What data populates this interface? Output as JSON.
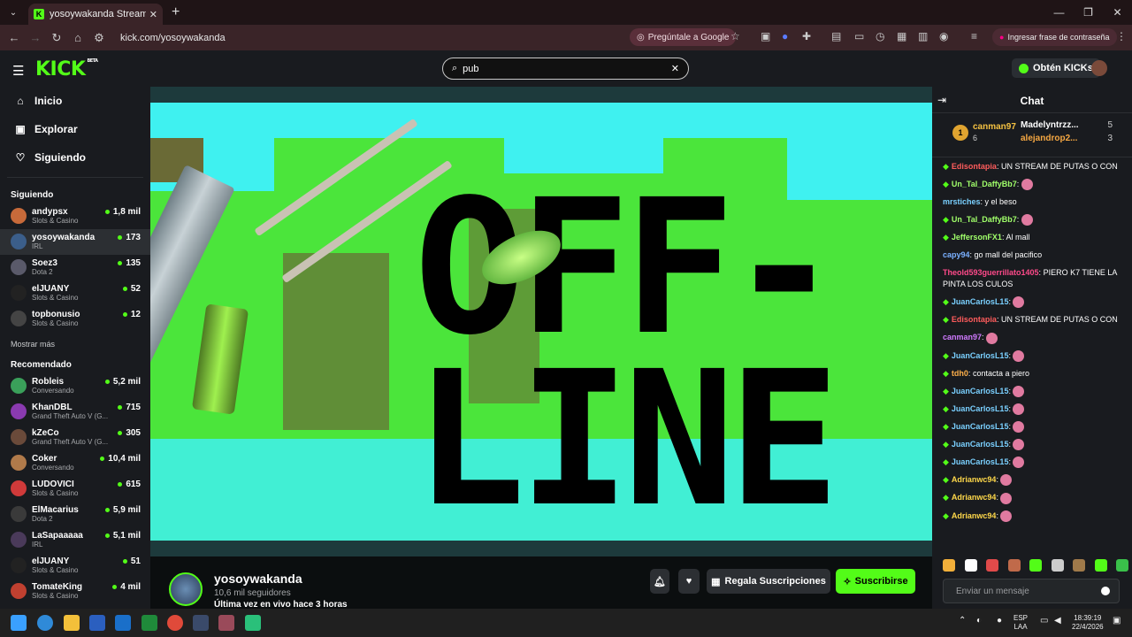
{
  "browser": {
    "tab_title": "yosoywakanda Stream - Watch",
    "url": "kick.com/yosoywakanda",
    "google_pill": "Pregúntale a Google",
    "password_pill": "Ingresar frase de contraseña"
  },
  "header": {
    "logo": "KICK",
    "logo_badge": "BETA",
    "search_value": "pub",
    "kicks_label": "Obtén KICKs"
  },
  "sidebar": {
    "nav": [
      {
        "label": "Inicio",
        "icon": "home-icon"
      },
      {
        "label": "Explorar",
        "icon": "compass-icon"
      },
      {
        "label": "Siguiendo",
        "icon": "heart-icon"
      }
    ],
    "following_title": "Siguiendo",
    "following": [
      {
        "name": "andypsx",
        "category": "Slots & Casino",
        "viewers": "1,8 mil",
        "color": "#c76a3a"
      },
      {
        "name": "yosoywakanda",
        "category": "IRL",
        "viewers": "173",
        "color": "#3b5e8a"
      },
      {
        "name": "Soez3",
        "category": "Dota 2",
        "viewers": "135",
        "color": "#5a5a6a"
      },
      {
        "name": "elJUANY",
        "category": "Slots & Casino",
        "viewers": "52",
        "color": "#222"
      },
      {
        "name": "topbonusio",
        "category": "Slots & Casino",
        "viewers": "12",
        "color": "#444"
      }
    ],
    "show_more": "Mostrar más",
    "recommended_title": "Recomendado",
    "recommended": [
      {
        "name": "Robleis",
        "category": "Conversando",
        "viewers": "5,2 mil",
        "color": "#3aa05a"
      },
      {
        "name": "KhanDBL",
        "category": "Grand Theft Auto V (G...",
        "viewers": "715",
        "color": "#8a3ab0"
      },
      {
        "name": "kZeCo",
        "category": "Grand Theft Auto V (G...",
        "viewers": "305",
        "color": "#6a4a3a"
      },
      {
        "name": "Coker",
        "category": "Conversando",
        "viewers": "10,4 mil",
        "color": "#b07a4a"
      },
      {
        "name": "LUDOVICI",
        "category": "Slots & Casino",
        "viewers": "615",
        "color": "#d03a3a"
      },
      {
        "name": "ElMacarius",
        "category": "Dota 2",
        "viewers": "5,9 mil",
        "color": "#3a3a3a"
      },
      {
        "name": "LaSapaaaaa",
        "category": "IRL",
        "viewers": "5,1 mil",
        "color": "#4a3a5a"
      },
      {
        "name": "elJUANY",
        "category": "Slots & Casino",
        "viewers": "51",
        "color": "#222"
      },
      {
        "name": "TomateKing",
        "category": "Slots & Casino",
        "viewers": "4 mil",
        "color": "#c04030"
      }
    ]
  },
  "player": {
    "offline_line1": "OFF-",
    "offline_line2": "LINE"
  },
  "channel": {
    "name": "yosoywakanda",
    "followers": "10,6 mil seguidores",
    "last_live": "Última vez en vivo hace 3 horas",
    "gift_label": "Regala Suscripciones",
    "subscribe_label": "Suscribirse"
  },
  "chat": {
    "title": "Chat",
    "leaderboard": [
      {
        "rank": "1",
        "name": "canman97",
        "value": "6"
      },
      {
        "name": "Madelyntrzz...",
        "value": "5"
      },
      {
        "name": "alejandrop2...",
        "value": "3"
      }
    ],
    "messages": [
      {
        "user": "Edisontapia",
        "text": "UN STREAM DE PUTAS O CON",
        "color": "#ff5c5c",
        "badge": true
      },
      {
        "user": "Un_Tal_DaffyBb7",
        "text": "",
        "color": "#a0ff6a",
        "badge": true
      },
      {
        "user": "mrstiches",
        "text": "y el beso",
        "color": "#7ad0ff",
        "badge": false
      },
      {
        "user": "Un_Tal_DaffyBb7",
        "text": "",
        "color": "#a0ff6a",
        "badge": true
      },
      {
        "user": "JeffersonFX1",
        "text": "Al mall",
        "color": "#a0ff6a",
        "badge": true
      },
      {
        "user": "capy94",
        "text": "go mall del pacifico",
        "color": "#7ab0ff",
        "badge": false
      },
      {
        "user": "Theold593guerrillato1405",
        "text": "PIERO K7 TIENE LA PINTA LOS CULOS",
        "color": "#ff4a8a",
        "badge": false
      },
      {
        "user": "JuanCarlosL15",
        "text": "",
        "color": "#7ad0ff",
        "badge": true
      },
      {
        "user": "Edisontapia",
        "text": "UN STREAM DE PUTAS O CON",
        "color": "#ff5c5c",
        "badge": true
      },
      {
        "user": "canman97",
        "text": "",
        "color": "#d07aff",
        "badge": false
      },
      {
        "user": "JuanCarlosL15",
        "text": "",
        "color": "#7ad0ff",
        "badge": true
      },
      {
        "user": "tdh0",
        "text": "contacta a piero",
        "color": "#ffb04a",
        "badge": true
      },
      {
        "user": "JuanCarlosL15",
        "text": "",
        "color": "#7ad0ff",
        "badge": true
      },
      {
        "user": "JuanCarlosL15",
        "text": "",
        "color": "#7ad0ff",
        "badge": true
      },
      {
        "user": "JuanCarlosL15",
        "text": "",
        "color": "#7ad0ff",
        "badge": true
      },
      {
        "user": "JuanCarlosL15",
        "text": "",
        "color": "#7ad0ff",
        "badge": true
      },
      {
        "user": "JuanCarlosL15",
        "text": "",
        "color": "#7ad0ff",
        "badge": true
      },
      {
        "user": "Adrianwc94",
        "text": "",
        "color": "#ffd84a",
        "badge": true
      },
      {
        "user": "Adrianwc94",
        "text": "",
        "color": "#ffd84a",
        "badge": true
      },
      {
        "user": "Adrianwc94",
        "text": "",
        "color": "#ffd84a",
        "badge": true
      }
    ],
    "input_placeholder": "Enviar un mensaje"
  },
  "taskbar": {
    "lang": "ESP",
    "lang2": "LAA",
    "time": "18:39:19",
    "date": "22/4/2026"
  },
  "colors": {
    "accent": "#53fc18"
  }
}
